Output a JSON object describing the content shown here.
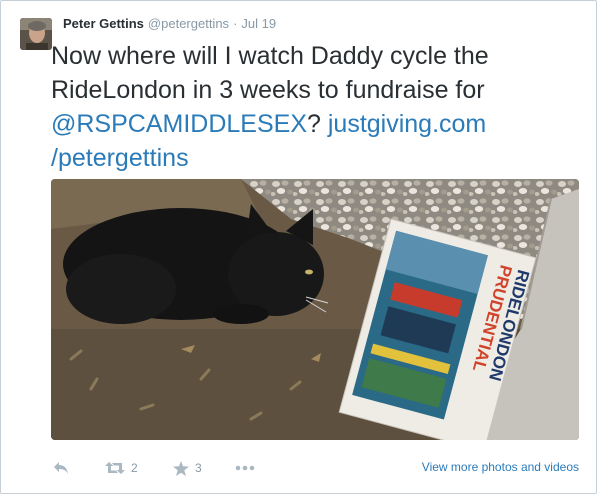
{
  "tweet": {
    "author_name": "Peter Gettins",
    "author_handle": "@petergettins",
    "separator": "·",
    "timestamp": "Jul 19",
    "text_plain_1": "Now where will I watch Daddy cycle the RideLondon in 3 weeks to fundraise for ",
    "mention": "@RSPCAMIDDLESEX",
    "text_plain_2": "? ",
    "link_part_1": "justgiving.com",
    "link_part_2": "/petergettins"
  },
  "photo": {
    "magazine_title_line_1": "PRUDENTIAL",
    "magazine_title_line_2": "RIDELONDON"
  },
  "actions": {
    "retweet_count": "2",
    "favorite_count": "3",
    "view_more_label": "View more photos and videos"
  },
  "colors": {
    "link": "#2b7bb9",
    "text": "#292f33",
    "muted": "#8899a6",
    "icon": "#aab8c2"
  }
}
